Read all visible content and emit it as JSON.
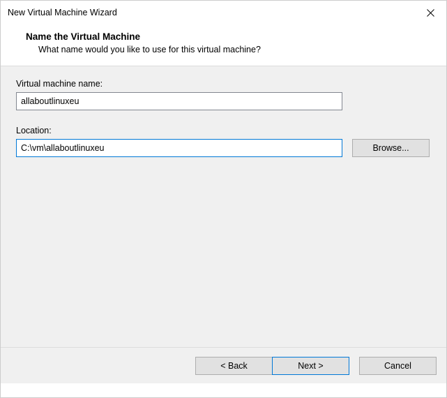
{
  "window": {
    "title": "New Virtual Machine Wizard"
  },
  "header": {
    "heading": "Name the Virtual Machine",
    "subtext": "What name would you like to use for this virtual machine?"
  },
  "form": {
    "name_label": "Virtual machine name:",
    "name_value": "allaboutlinuxeu",
    "location_label": "Location:",
    "location_value": "C:\\vm\\allaboutlinuxeu",
    "browse_label": "Browse..."
  },
  "footer": {
    "back_label": "< Back",
    "next_label": "Next >",
    "cancel_label": "Cancel"
  }
}
